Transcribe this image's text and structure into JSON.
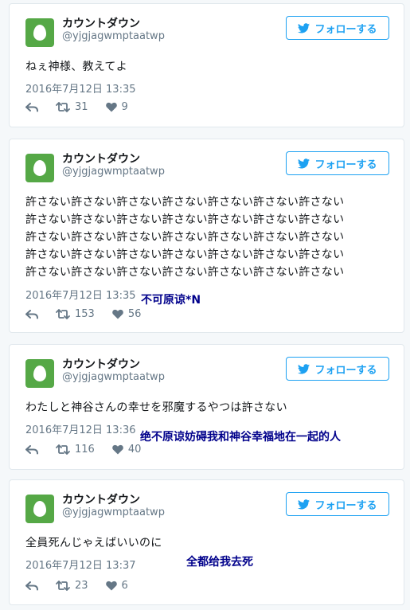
{
  "tweets": [
    {
      "name": "カウントダウン",
      "handle": "@yjgjagwmptaatwp",
      "follow_label": "フォローする",
      "lines": [
        "ねぇ神様、教えてよ"
      ],
      "timestamp": "2016年7月12日 13:35",
      "retweets": "31",
      "likes": "9",
      "note": ""
    },
    {
      "name": "カウントダウン",
      "handle": "@yjgjagwmptaatwp",
      "follow_label": "フォローする",
      "lines": [
        "許さない許さない許さない許さない許さない許さない許さない",
        "許さない許さない許さない許さない許さない許さない許さない",
        "許さない許さない許さない許さない許さない許さない許さない",
        "許さない許さない許さない許さない許さない許さない許さない",
        "許さない許さない許さない許さない許さない許さない許さない"
      ],
      "timestamp": "2016年7月12日 13:35",
      "retweets": "153",
      "likes": "56",
      "note": "不可原谅*N"
    },
    {
      "name": "カウントダウン",
      "handle": "@yjgjagwmptaatwp",
      "follow_label": "フォローする",
      "lines": [
        "わたしと神谷さんの幸せを邪魔するやつは許さない"
      ],
      "timestamp": "2016年7月12日 13:36",
      "retweets": "116",
      "likes": "40",
      "note": "绝不原谅妨碍我和神谷幸福地在一起的人"
    },
    {
      "name": "カウントダウン",
      "handle": "@yjgjagwmptaatwp",
      "follow_label": "フォローする",
      "lines": [
        "全員死んじゃえばいいのに"
      ],
      "timestamp": "2016年7月12日 13:37",
      "retweets": "23",
      "likes": "6",
      "note": "全都给我去死"
    }
  ],
  "colors": {
    "accent": "#1da1f2",
    "avatar": "#55a846",
    "note": "#00008b",
    "muted": "#657786"
  },
  "icons": [
    "twitter-bird-icon",
    "reply-icon",
    "retweet-icon",
    "heart-icon",
    "egg-avatar-icon"
  ]
}
